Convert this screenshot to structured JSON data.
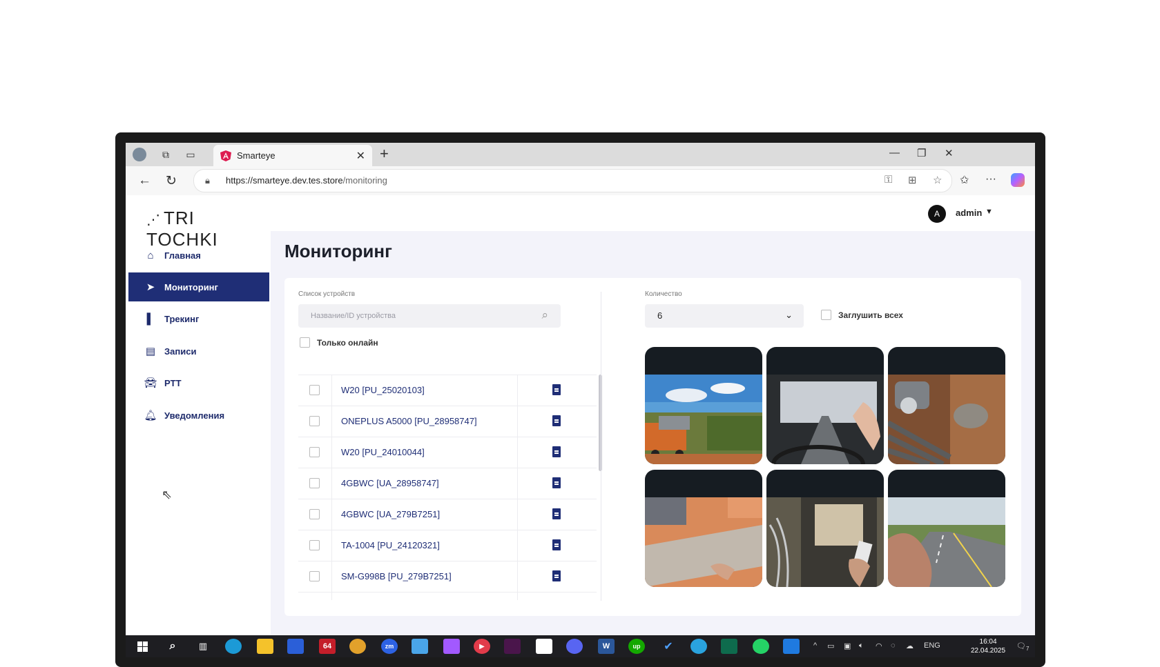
{
  "browser": {
    "tab_title": "Smarteye",
    "url_host": "https://smarteye.dev.tes.store",
    "url_path": "/monitoring"
  },
  "app": {
    "logo": "TRI TOCHKI",
    "user": {
      "initial": "A",
      "name": "admin"
    },
    "sidebar": [
      {
        "label": "Главная",
        "icon": "home-icon"
      },
      {
        "label": "Мониторинг",
        "icon": "navigation-arrow-icon",
        "active": true
      },
      {
        "label": "Трекинг",
        "icon": "bar-chart-icon"
      },
      {
        "label": "Записи",
        "icon": "document-icon"
      },
      {
        "label": "PTT",
        "icon": "car-icon"
      },
      {
        "label": "Уведомления",
        "icon": "bell-icon"
      }
    ],
    "page_title": "Мониторинг",
    "devices": {
      "label": "Список устройств",
      "search_placeholder": "Название/ID устройства",
      "only_online": "Только онлайн",
      "items": [
        "W20 [PU_25020103]",
        "ONEPLUS A5000 [PU_28958747]",
        "W20 [PU_24010044]",
        "4GBWC [UA_28958747]",
        "4GBWC [UA_279B7251]",
        "TA-1004 [PU_24120321]",
        "SM-G998B [PU_279B7251]"
      ]
    },
    "quantity": {
      "label": "Количество",
      "value": "6"
    },
    "mute_all": "Заглушить всех"
  },
  "taskbar": {
    "lang": "ENG",
    "time": "16:04",
    "date": "22.04.2025",
    "notifications": "7"
  }
}
